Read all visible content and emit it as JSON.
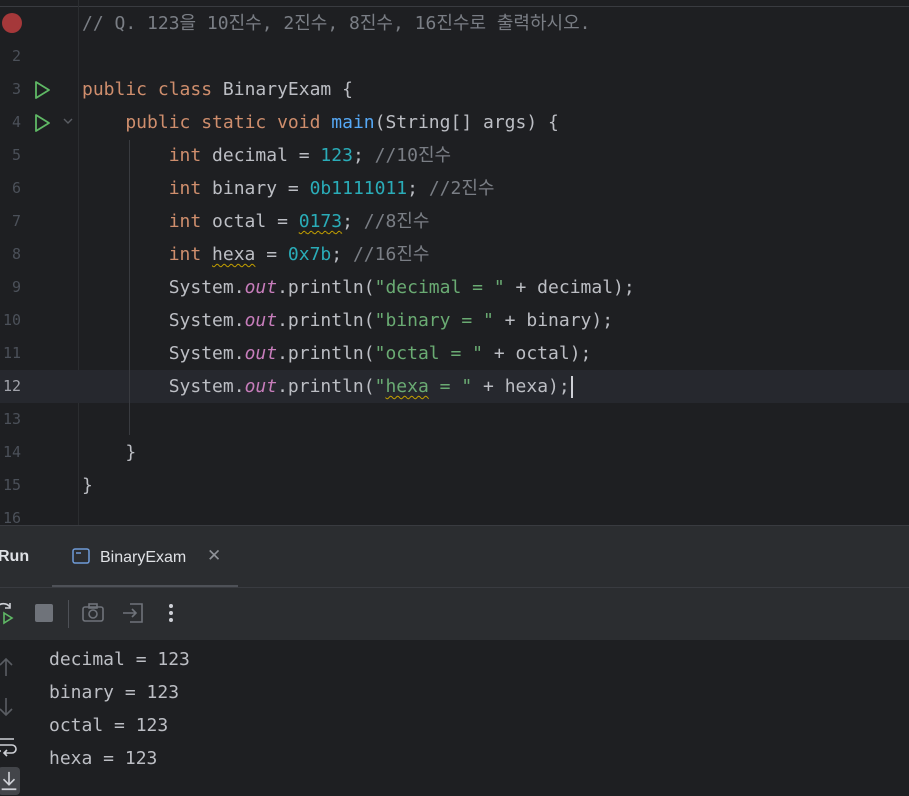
{
  "editor": {
    "lines": [
      {
        "num": "",
        "tokens": [
          {
            "t": "// Q. 123을 10진수, 2진수, 8진수, 16진수로 출력하시오.",
            "c": "cmt"
          }
        ]
      },
      {
        "num": "2",
        "tokens": []
      },
      {
        "num": "3",
        "tokens": [
          {
            "t": "public ",
            "c": "kw"
          },
          {
            "t": "class ",
            "c": "kw"
          },
          {
            "t": "BinaryExam {",
            "c": ""
          }
        ]
      },
      {
        "num": "4",
        "tokens": [
          {
            "t": "    public ",
            "c": "kw"
          },
          {
            "t": "static ",
            "c": "kw"
          },
          {
            "t": "void ",
            "c": "kw"
          },
          {
            "t": "main",
            "c": "fn"
          },
          {
            "t": "(String[] args) {",
            "c": ""
          }
        ]
      },
      {
        "num": "5",
        "tokens": [
          {
            "t": "        int ",
            "c": "kw"
          },
          {
            "t": "decimal = ",
            "c": ""
          },
          {
            "t": "123",
            "c": "num"
          },
          {
            "t": "; ",
            "c": ""
          },
          {
            "t": "//10진수",
            "c": "cmt"
          }
        ]
      },
      {
        "num": "6",
        "tokens": [
          {
            "t": "        int ",
            "c": "kw"
          },
          {
            "t": "binary = ",
            "c": ""
          },
          {
            "t": "0b1111011",
            "c": "num"
          },
          {
            "t": "; ",
            "c": ""
          },
          {
            "t": "//2진수",
            "c": "cmt"
          }
        ]
      },
      {
        "num": "7",
        "tokens": [
          {
            "t": "        int ",
            "c": "kw"
          },
          {
            "t": "octal = ",
            "c": ""
          },
          {
            "t": "0173",
            "c": "num squig"
          },
          {
            "t": "; ",
            "c": ""
          },
          {
            "t": "//8진수",
            "c": "cmt"
          }
        ]
      },
      {
        "num": "8",
        "tokens": [
          {
            "t": "        int ",
            "c": "kw"
          },
          {
            "t": "hexa",
            "c": "squig"
          },
          {
            "t": " = ",
            "c": ""
          },
          {
            "t": "0x7b",
            "c": "num"
          },
          {
            "t": "; ",
            "c": ""
          },
          {
            "t": "//16진수",
            "c": "cmt"
          }
        ]
      },
      {
        "num": "9",
        "tokens": [
          {
            "t": "        System.",
            "c": ""
          },
          {
            "t": "out",
            "c": "stat"
          },
          {
            "t": ".println(",
            "c": ""
          },
          {
            "t": "\"decimal = \"",
            "c": "str"
          },
          {
            "t": " + decimal);",
            "c": ""
          }
        ]
      },
      {
        "num": "10",
        "tokens": [
          {
            "t": "        System.",
            "c": ""
          },
          {
            "t": "out",
            "c": "stat"
          },
          {
            "t": ".println(",
            "c": ""
          },
          {
            "t": "\"binary = \"",
            "c": "str"
          },
          {
            "t": " + binary);",
            "c": ""
          }
        ]
      },
      {
        "num": "11",
        "tokens": [
          {
            "t": "        System.",
            "c": ""
          },
          {
            "t": "out",
            "c": "stat"
          },
          {
            "t": ".println(",
            "c": ""
          },
          {
            "t": "\"octal = \"",
            "c": "str"
          },
          {
            "t": " + octal);",
            "c": ""
          }
        ]
      },
      {
        "num": "12",
        "tokens": [
          {
            "t": "        System.",
            "c": ""
          },
          {
            "t": "out",
            "c": "stat"
          },
          {
            "t": ".println(",
            "c": ""
          },
          {
            "t": "\"",
            "c": "str"
          },
          {
            "t": "hexa",
            "c": "str squig"
          },
          {
            "t": " = \"",
            "c": "str"
          },
          {
            "t": " + hexa);",
            "c": ""
          }
        ]
      },
      {
        "num": "13",
        "tokens": []
      },
      {
        "num": "14",
        "tokens": [
          {
            "t": "    }",
            "c": ""
          }
        ]
      },
      {
        "num": "15",
        "tokens": [
          {
            "t": "}",
            "c": ""
          }
        ]
      },
      {
        "num": "16",
        "tokens": []
      }
    ],
    "current_line": "12"
  },
  "run_panel": {
    "title": "Run",
    "tab_label": "BinaryExam",
    "tab_close": "✕",
    "console": [
      "decimal = 123",
      "binary = 123",
      "octal = 123",
      "hexa = 123"
    ]
  },
  "icons": {
    "run": "run-gutter-icon",
    "breakpoint": "breakpoint-icon",
    "rerun": "rerun-icon",
    "stop": "stop-icon",
    "screenshot": "camera-icon",
    "exit": "exit-icon",
    "more": "more-vertical-icon",
    "up": "arrow-up-icon",
    "down": "arrow-down-icon",
    "wrap": "soft-wrap-icon",
    "scroll": "scroll-to-end-icon"
  },
  "colors": {
    "background": "#1e1f22",
    "keyword": "#cf8e6d",
    "function": "#56a8f5",
    "number": "#2aacb8",
    "string": "#6aab73",
    "comment": "#7a7e85",
    "static_field": "#c77dbb",
    "run_green": "#5fb865"
  }
}
